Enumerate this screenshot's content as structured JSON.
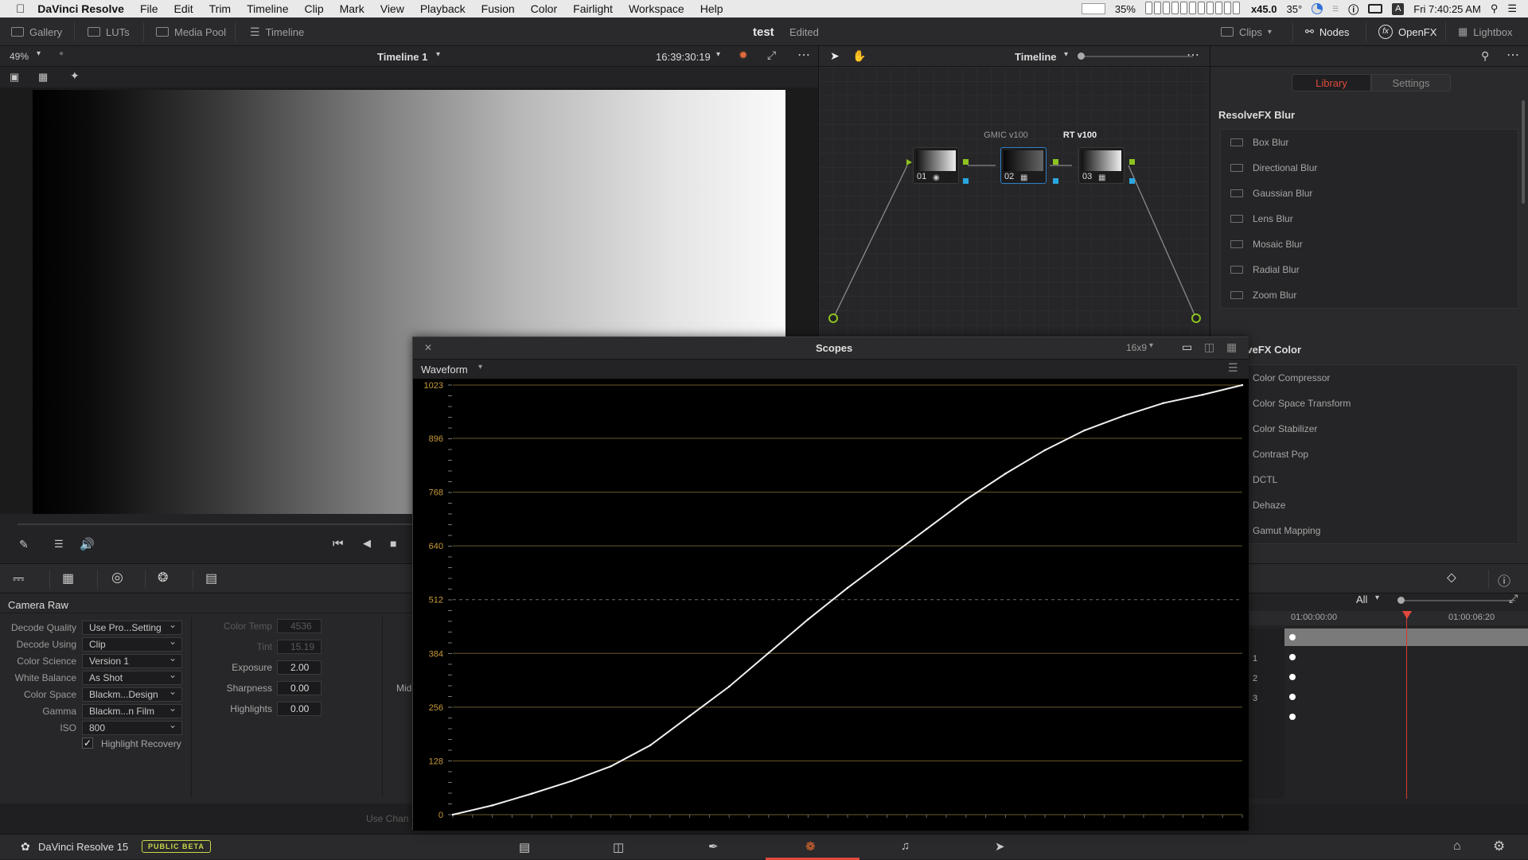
{
  "menubar": {
    "app_name": "DaVinci Resolve",
    "items": [
      "File",
      "Edit",
      "Trim",
      "Timeline",
      "Clip",
      "Mark",
      "View",
      "Playback",
      "Fusion",
      "Color",
      "Fairlight",
      "Workspace",
      "Help"
    ],
    "battery_pct": "35%",
    "zoom": "x45.0",
    "temp": "35°",
    "clock": "Fri 7:40:25 AM"
  },
  "toolbar": {
    "gallery": "Gallery",
    "luts": "LUTs",
    "media_pool": "Media Pool",
    "timeline": "Timeline",
    "project_name": "test",
    "project_status": "Edited",
    "clips": "Clips",
    "nodes": "Nodes",
    "openfx": "OpenFX",
    "lightbox": "Lightbox"
  },
  "viewer": {
    "zoom": "49%",
    "timeline_name": "Timeline 1",
    "timecode": "16:39:30:19"
  },
  "node_editor": {
    "mode": "Timeline",
    "nodes": [
      {
        "num": "01",
        "label": ""
      },
      {
        "num": "02",
        "label": "GMIC v100"
      },
      {
        "num": "03",
        "label": "RT v100"
      }
    ]
  },
  "fx_panel": {
    "tab_library": "Library",
    "tab_settings": "Settings",
    "groups": [
      {
        "title": "ResolveFX Blur",
        "items": [
          "Box Blur",
          "Directional Blur",
          "Gaussian Blur",
          "Lens Blur",
          "Mosaic Blur",
          "Radial Blur",
          "Zoom Blur"
        ]
      },
      {
        "title": "ResolveFX Color",
        "items": [
          "Color Compressor",
          "Color Space Transform",
          "Color Stabilizer",
          "Contrast Pop",
          "DCTL",
          "Dehaze",
          "Gamut Mapping"
        ]
      }
    ]
  },
  "camera_raw": {
    "title": "Camera Raw",
    "fields": [
      {
        "label": "Decode Quality",
        "value": "Use Pro...Setting"
      },
      {
        "label": "Decode Using",
        "value": "Clip"
      },
      {
        "label": "Color Science",
        "value": "Version 1"
      },
      {
        "label": "White Balance",
        "value": "As Shot"
      },
      {
        "label": "Color Space",
        "value": "Blackm...Design"
      },
      {
        "label": "Gamma",
        "value": "Blackm...n Film"
      },
      {
        "label": "ISO",
        "value": "800"
      }
    ],
    "highlight_recovery": "Highlight Recovery",
    "color_temp_label": "Color Temp",
    "color_temp": "4536",
    "tint_label": "Tint",
    "tint": "15.19",
    "exposure_label": "Exposure",
    "exposure": "2.00",
    "sharpness_label": "Sharpness",
    "sharpness": "0.00",
    "highlights_label": "Highlights",
    "highlights": "0.00",
    "mid_label": "Mid",
    "use_change": "Use Chan"
  },
  "keyframes": {
    "filter": "All",
    "tc_start": "01:00:00:00",
    "tc_end": "01:00:06:20",
    "rows": [
      "",
      "1",
      "2",
      "3",
      ""
    ]
  },
  "scopes": {
    "title": "Scopes",
    "aspect": "16x9",
    "mode": "Waveform",
    "chart_data": {
      "type": "line",
      "title": "",
      "xlabel": "",
      "ylabel": "",
      "ylim": [
        0,
        1023
      ],
      "y_ticks": [
        0,
        128,
        256,
        384,
        512,
        640,
        768,
        896,
        1023
      ],
      "xlim": [
        0,
        100
      ],
      "series": [
        {
          "x": [
            0,
            5,
            10,
            15,
            20,
            25,
            30,
            35,
            40,
            45,
            50,
            55,
            60,
            65,
            70,
            75,
            80,
            85,
            90,
            95,
            100
          ],
          "values": [
            0,
            22,
            50,
            80,
            115,
            165,
            235,
            305,
            385,
            465,
            540,
            610,
            680,
            750,
            812,
            868,
            915,
            950,
            980,
            1000,
            1023
          ]
        }
      ],
      "grid": true
    }
  },
  "status": {
    "app_version": "DaVinci Resolve 15",
    "badge": "PUBLIC BETA"
  }
}
